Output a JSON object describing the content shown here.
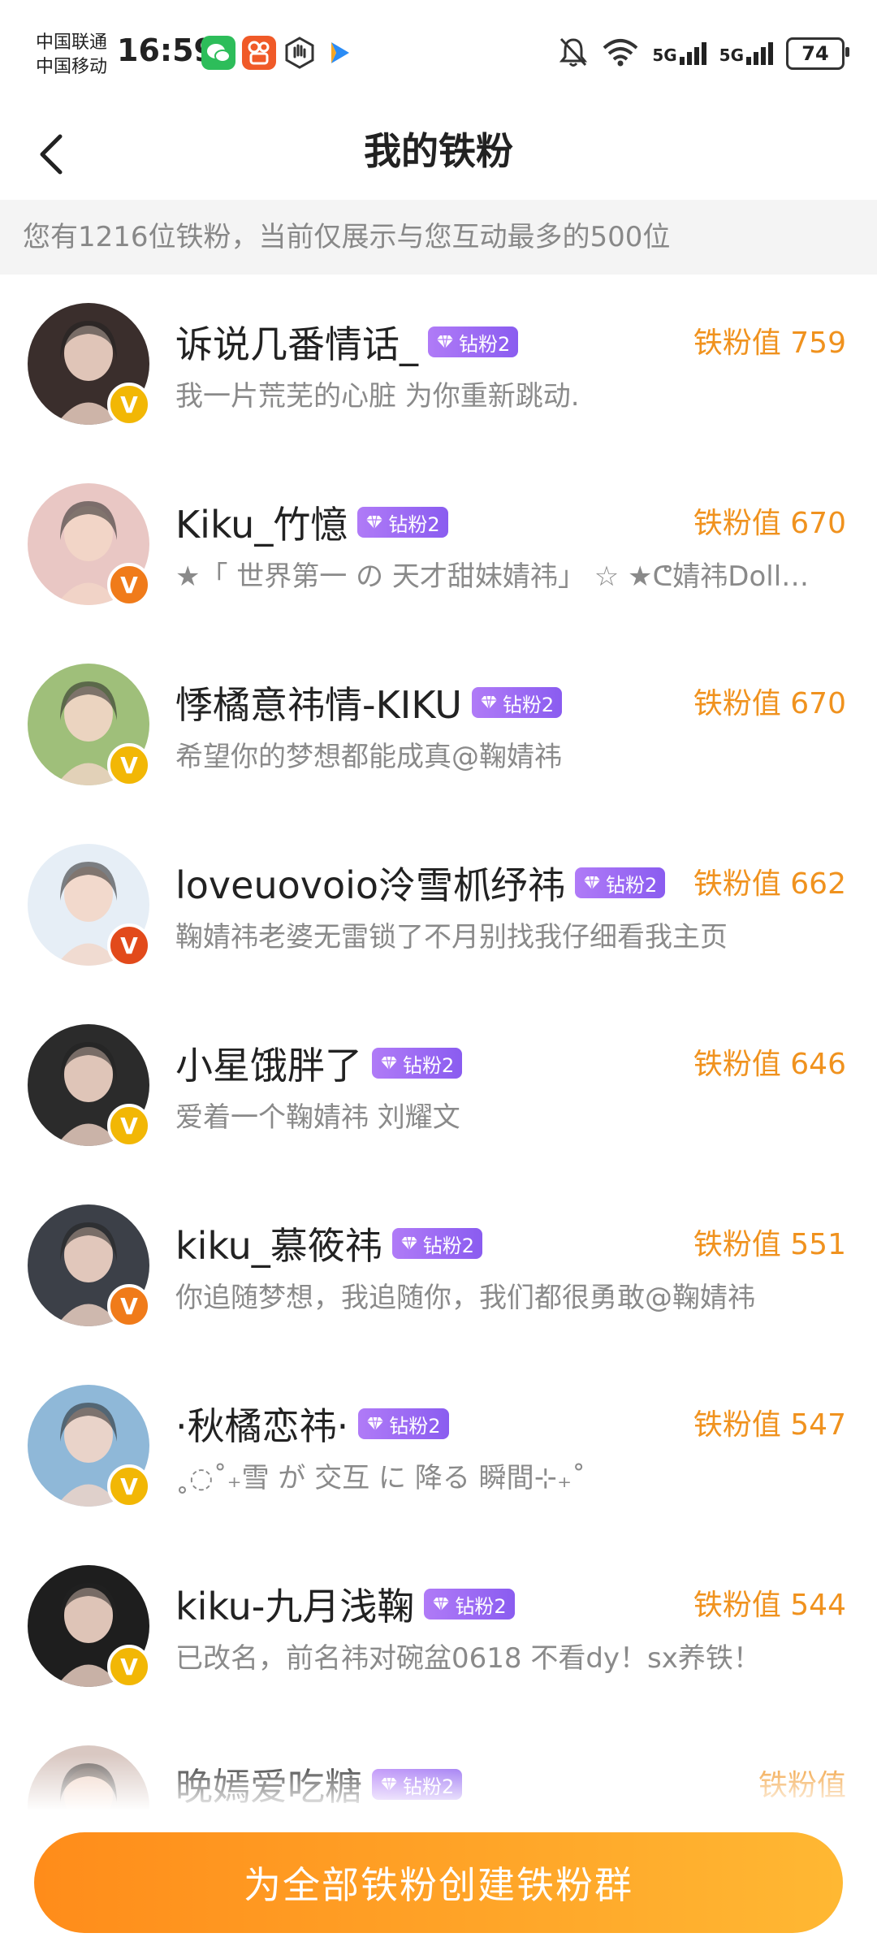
{
  "status_bar": {
    "carrier1": "中国联通",
    "carrier2": "中国移动",
    "time": "16:59",
    "signal1": "5G",
    "signal2": "5G",
    "battery": "74"
  },
  "header": {
    "title": "我的铁粉"
  },
  "notice": "您有1216位铁粉，当前仅展示与您互动最多的500位",
  "fans": [
    {
      "name": "诉说几番情话_",
      "tag": "钻粉2",
      "value": "铁粉值 759",
      "signature": "我一片荒芜的心脏 为你重新跳动.",
      "avatar": "#3a2e2c",
      "badge": "#f2b705"
    },
    {
      "name": "Kiku_竹憶",
      "tag": "钻粉2",
      "value": "铁粉值 670",
      "signature": "★「 世界第一 の 天才甜妹婧祎」 ☆ ★ᕦ婧祎Doll…",
      "avatar": "#e9c7c4",
      "badge": "#f07b1a"
    },
    {
      "name": "悸橘意祎情-KIKU",
      "tag": "钻粉2",
      "value": "铁粉值 670",
      "signature": "希望你的梦想都能成真@鞠婧祎",
      "avatar": "#9fbf7a",
      "badge": "#f2b705"
    },
    {
      "name": "loveuovoio泠雪枛纾祎",
      "tag": "钻粉2",
      "value": "铁粉值 662",
      "signature": "鞠婧祎老婆无雷锁了不月别找我仔细看我主页",
      "avatar": "#e6eef6",
      "badge": "#e24a1b"
    },
    {
      "name": "小星饿胖了",
      "tag": "钻粉2",
      "value": "铁粉值 646",
      "signature": "爱着一个鞠婧祎 刘耀文",
      "avatar": "#2b2b2b",
      "badge": "#f2b705"
    },
    {
      "name": "kiku_慕筱祎",
      "tag": "钻粉2",
      "value": "铁粉值 551",
      "signature": "你追随梦想，我追随你，我们都很勇敢@鞠婧祎",
      "avatar": "#3c4048",
      "badge": "#f07b1a"
    },
    {
      "name": "·秋橘恋祎·",
      "tag": "钻粉2",
      "value": "铁粉值 547",
      "signature": "˳◌˚₊雪 が 交互 に 降る 瞬間⊹₊˚",
      "avatar": "#8fb8d8",
      "badge": "#f2b705"
    },
    {
      "name": "kiku-九月浅鞠",
      "tag": "钻粉2",
      "value": "铁粉值 544",
      "signature": "已改名，前名祎对碗盆0618 不看dy！sx养铁！",
      "avatar": "#1e1e1e",
      "badge": "#f2b705"
    },
    {
      "name": "晚嫣爱吃糖",
      "tag": "钻粉2",
      "value": "铁粉值",
      "signature": "",
      "avatar": "#d9c8c2",
      "badge": "#f2b705"
    }
  ],
  "footer": {
    "button": "为全部铁粉创建铁粉群"
  }
}
